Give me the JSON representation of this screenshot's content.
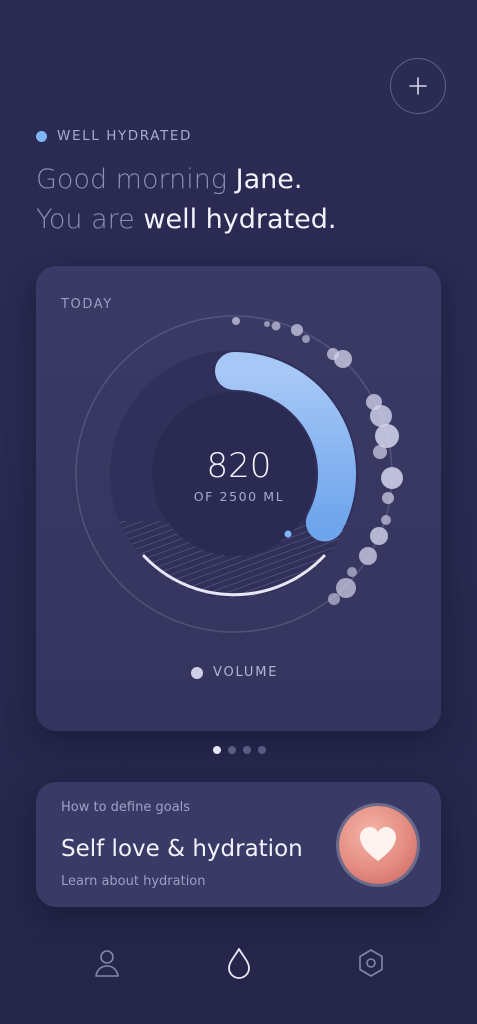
{
  "header": {
    "status_label": "WELL HYDRATED",
    "greeting_line1_prefix": "Good morning ",
    "greeting_line1_name": "Jane.",
    "greeting_line2_prefix": "You are ",
    "greeting_line2_status": "well hydrated."
  },
  "add_button": {
    "icon": "plus-icon"
  },
  "today_card": {
    "label": "TODAY",
    "value": "820",
    "goal_text": "OF 2500 ML",
    "progress": 0.328,
    "legend_label": "VOLUME"
  },
  "pager": {
    "count": 4,
    "active_index": 0
  },
  "info_card": {
    "kicker": "How to define goals",
    "title": "Self love & hydration",
    "subtitle": "Learn about hydration",
    "icon": "heart-icon"
  },
  "tabbar": [
    "profile-icon",
    "drop-icon",
    "settings-icon"
  ],
  "colors": {
    "background": "#2a2a52",
    "card": "#3a3a66",
    "accent_blue": "#8fbdf5",
    "status_dot": "#7fb5f5",
    "heart": "#e48b80"
  }
}
